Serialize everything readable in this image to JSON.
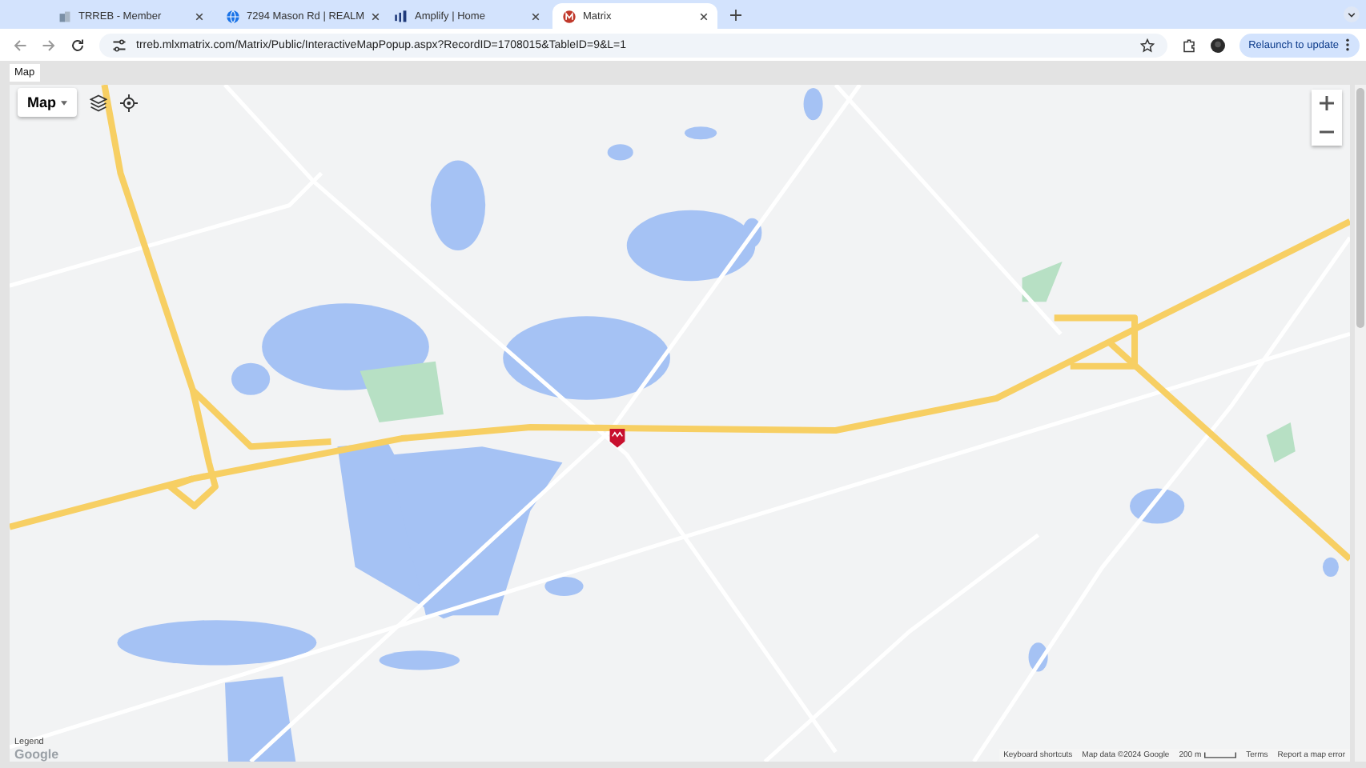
{
  "tabs": [
    {
      "title": "TRREB - Member",
      "selected": false
    },
    {
      "title": "7294 Mason Rd | REALM",
      "selected": false
    },
    {
      "title": "Amplify | Home",
      "selected": false
    },
    {
      "title": "Matrix",
      "selected": true
    }
  ],
  "address_bar": {
    "url": "trreb.mlxmatrix.com/Matrix/Public/InteractiveMapPopup.aspx?RecordID=1708015&TableID=9&L=1"
  },
  "relaunch_button": {
    "label": "Relaunch to update"
  },
  "page_tab": {
    "label": "Map"
  },
  "map": {
    "type_button": {
      "label": "Map"
    },
    "legend": "Legend",
    "logo": "Google",
    "footer": [
      {
        "kind": "link",
        "text": "Keyboard shortcuts"
      },
      {
        "kind": "text",
        "text": "Map data ©2024 Google"
      },
      {
        "kind": "scale",
        "text": "200 m"
      },
      {
        "kind": "link",
        "text": "Terms"
      },
      {
        "kind": "link",
        "text": "Report a map error"
      }
    ]
  }
}
